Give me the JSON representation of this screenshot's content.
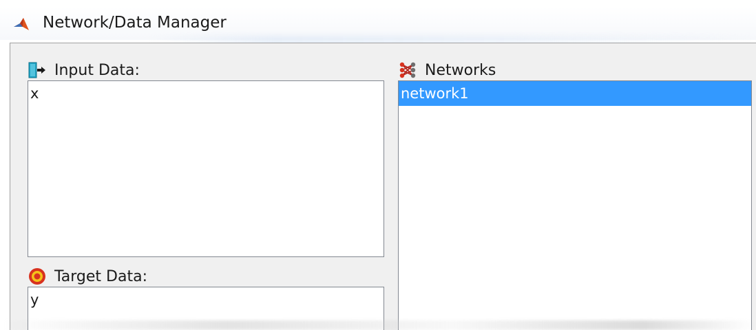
{
  "window": {
    "title": "Network/Data Manager",
    "icon": "matlab-icon"
  },
  "input_data": {
    "label": "Input Data:",
    "icon": "import-data-icon",
    "items": [
      "x"
    ]
  },
  "target_data": {
    "label": "Target Data:",
    "icon": "target-icon",
    "items": [
      "y"
    ]
  },
  "networks": {
    "label": "Networks",
    "icon": "network-icon",
    "items": [
      "network1"
    ],
    "selected": "network1"
  },
  "colors": {
    "selection": "#3399ff",
    "panel_background": "#f0f0f0",
    "list_background": "#ffffff"
  }
}
